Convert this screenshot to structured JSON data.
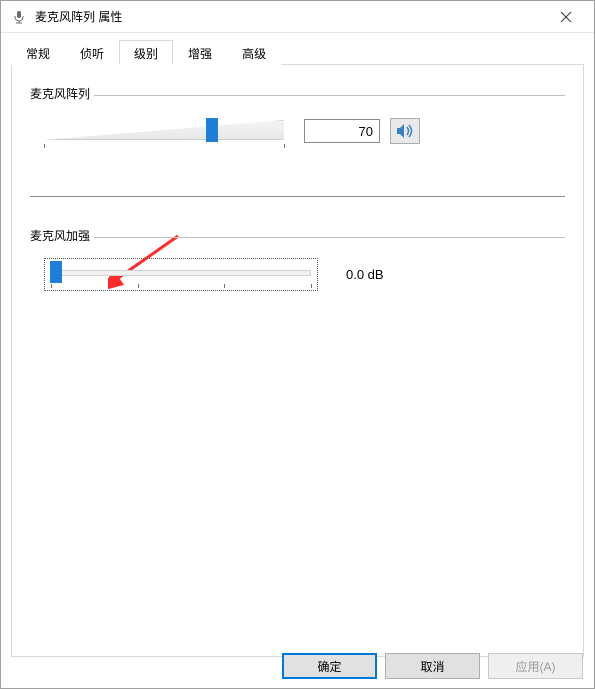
{
  "window": {
    "title": "麦克风阵列 属性"
  },
  "tabs": {
    "items": [
      {
        "label": "常规"
      },
      {
        "label": "侦听"
      },
      {
        "label": "级别"
      },
      {
        "label": "增强"
      },
      {
        "label": "高级"
      }
    ],
    "active_index": 2
  },
  "group1": {
    "label": "麦克风阵列",
    "value": "70",
    "slider_percent": 70,
    "icon_name": "speaker-icon"
  },
  "group2": {
    "label": "麦克风加强",
    "value": "0.0 dB",
    "slider_percent": 0
  },
  "buttons": {
    "ok": "确定",
    "cancel": "取消",
    "apply": "应用(A)"
  },
  "colors": {
    "accent": "#1e7fd6",
    "arrow": "#ff2a2a"
  }
}
